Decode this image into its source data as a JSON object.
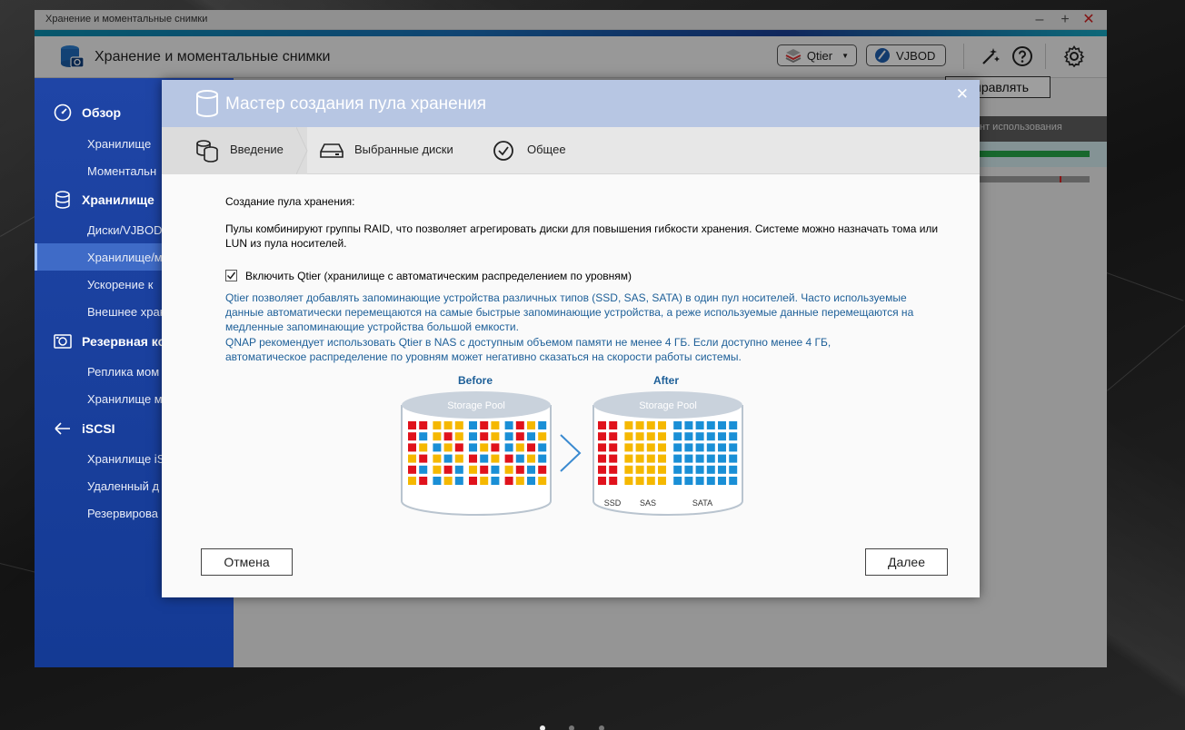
{
  "window": {
    "title": "Хранение и моментальные снимки",
    "controls": {
      "minimize": "–",
      "maximize": "+",
      "close": "✕"
    }
  },
  "header": {
    "app_title": "Хранение и моментальные снимки",
    "qtier_label": "Qtier",
    "vjbod_label": "VJBOD"
  },
  "sidebar": {
    "items": [
      {
        "label": "Обзор",
        "section": true,
        "icon": "gauge-icon"
      },
      {
        "label": "Хранилище",
        "section": false
      },
      {
        "label": "Моментальн",
        "section": false
      },
      {
        "label": "Хранилище",
        "section": true,
        "icon": "database-icon"
      },
      {
        "label": "Диски/VJBOD",
        "section": false
      },
      {
        "label": "Хранилище/м",
        "section": false,
        "active": true
      },
      {
        "label": "Ускорение к",
        "section": false
      },
      {
        "label": "Внешнее хран",
        "section": false
      },
      {
        "label": "Резервная ко",
        "section": true,
        "icon": "camera-icon"
      },
      {
        "label": "Реплика мом",
        "section": false
      },
      {
        "label": "Хранилище м",
        "section": false
      },
      {
        "label": "iSCSI",
        "section": true,
        "icon": "iscsi-icon"
      },
      {
        "label": "Хранилище iS",
        "section": false
      },
      {
        "label": "Удаленный д",
        "section": false
      },
      {
        "label": "Резервирова",
        "section": false
      }
    ]
  },
  "main": {
    "manage_label": "Управлять",
    "usage_header": "нт использования"
  },
  "dialog": {
    "title": "Мастер создания пула хранения",
    "close": "✕",
    "steps": [
      {
        "label": "Введение",
        "icon": "database-stack-icon"
      },
      {
        "label": "Выбранные диски",
        "icon": "disk-drive-icon"
      },
      {
        "label": "Общее",
        "icon": "check-circle-icon"
      }
    ],
    "heading": "Создание пула хранения:",
    "description": "Пулы комбинируют группы RAID, что позволяет агрегировать диски для повышения гибкости хранения. Системе можно назначать тома или LUN из пула носителей.",
    "qtier_checkbox_label": "Включить Qtier (хранилище с автоматическим распределением по уровням)",
    "qtier_checked": true,
    "qtier_info": "Qtier позволяет добавлять запоминающие устройства различных типов (SSD, SAS, SATA) в один пул носителей. Часто используемые данные автоматически перемещаются на самые быстрые запоминающие устройства, а реже используемые данные перемещаются на медленные запоминающие устройства большой емкости.",
    "qnap_recommend": "QNAP рекомендует использовать Qtier в NAS с доступным объемом памяти не менее 4 ГБ. Если доступно менее 4 ГБ, автоматическое распределение по уровням может негативно сказаться на скорости работы системы.",
    "illustration": {
      "before_label": "Before",
      "after_label": "After",
      "pool_label": "Storage Pool",
      "tiers": [
        "SSD",
        "SAS",
        "SATA"
      ],
      "colors": {
        "ssd": "#e0121c",
        "sas": "#f5b800",
        "sata": "#1a8fd6"
      }
    },
    "cancel_label": "Отмена",
    "next_label": "Далее"
  }
}
